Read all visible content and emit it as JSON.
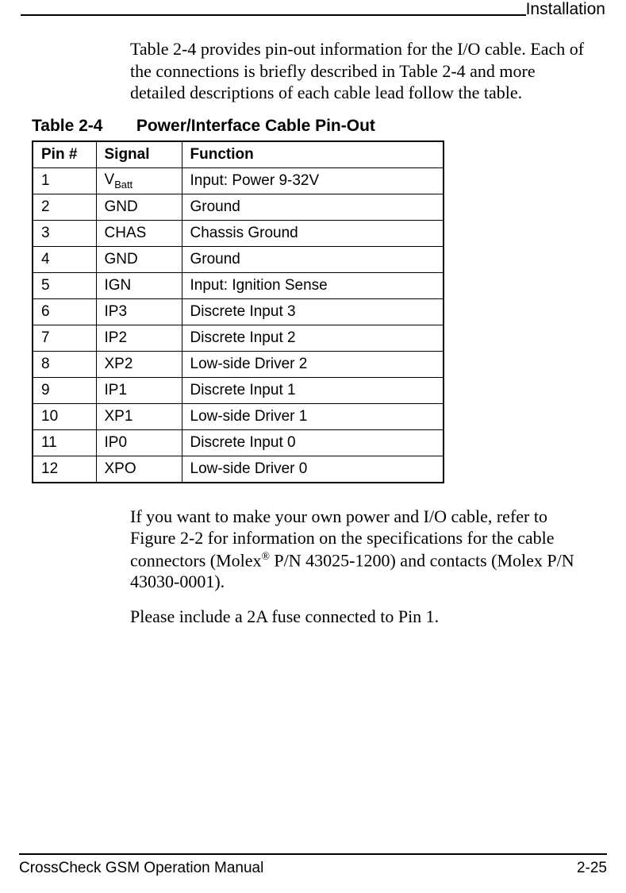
{
  "header": {
    "section": "Installation"
  },
  "intro": "Table 2-4 provides pin-out information for the I/O cable. Each of the connections is briefly described in Table 2-4 and more detailed descriptions of each cable lead follow the table.",
  "table": {
    "number": "Table 2-4",
    "title": "Power/Interface Cable Pin-Out",
    "headers": {
      "pin": "Pin #",
      "signal": "Signal",
      "function": "Function"
    },
    "rows": [
      {
        "pin": "1",
        "signal_main": "V",
        "signal_sub": "Batt",
        "function": "Input: Power 9-32V"
      },
      {
        "pin": "2",
        "signal_main": "GND",
        "signal_sub": "",
        "function": "Ground"
      },
      {
        "pin": "3",
        "signal_main": "CHAS",
        "signal_sub": "",
        "function": "Chassis Ground"
      },
      {
        "pin": "4",
        "signal_main": "GND",
        "signal_sub": "",
        "function": "Ground"
      },
      {
        "pin": "5",
        "signal_main": "IGN",
        "signal_sub": "",
        "function": "Input: Ignition Sense"
      },
      {
        "pin": "6",
        "signal_main": "IP3",
        "signal_sub": "",
        "function": "Discrete Input 3"
      },
      {
        "pin": "7",
        "signal_main": "IP2",
        "signal_sub": "",
        "function": "Discrete Input 2"
      },
      {
        "pin": "8",
        "signal_main": "XP2",
        "signal_sub": "",
        "function": "Low-side Driver 2"
      },
      {
        "pin": "9",
        "signal_main": "IP1",
        "signal_sub": "",
        "function": "Discrete Input 1"
      },
      {
        "pin": "10",
        "signal_main": "XP1",
        "signal_sub": "",
        "function": "Low-side Driver 1"
      },
      {
        "pin": "11",
        "signal_main": "IP0",
        "signal_sub": "",
        "function": "Discrete Input 0"
      },
      {
        "pin": "12",
        "signal_main": "XPO",
        "signal_sub": "",
        "function": "Low-side Driver 0"
      }
    ]
  },
  "para2_pre": "If you want to make your own power and I/O cable, refer to Figure 2-2 for information on the specifications for the cable connectors (Molex",
  "para2_reg": "®",
  "para2_post": " P/N 43025-1200) and contacts (Molex P/N 43030-0001).",
  "para3": "Please include a 2A fuse connected to Pin 1.",
  "footer": {
    "left": "CrossCheck GSM Operation Manual",
    "right": "2-25"
  }
}
